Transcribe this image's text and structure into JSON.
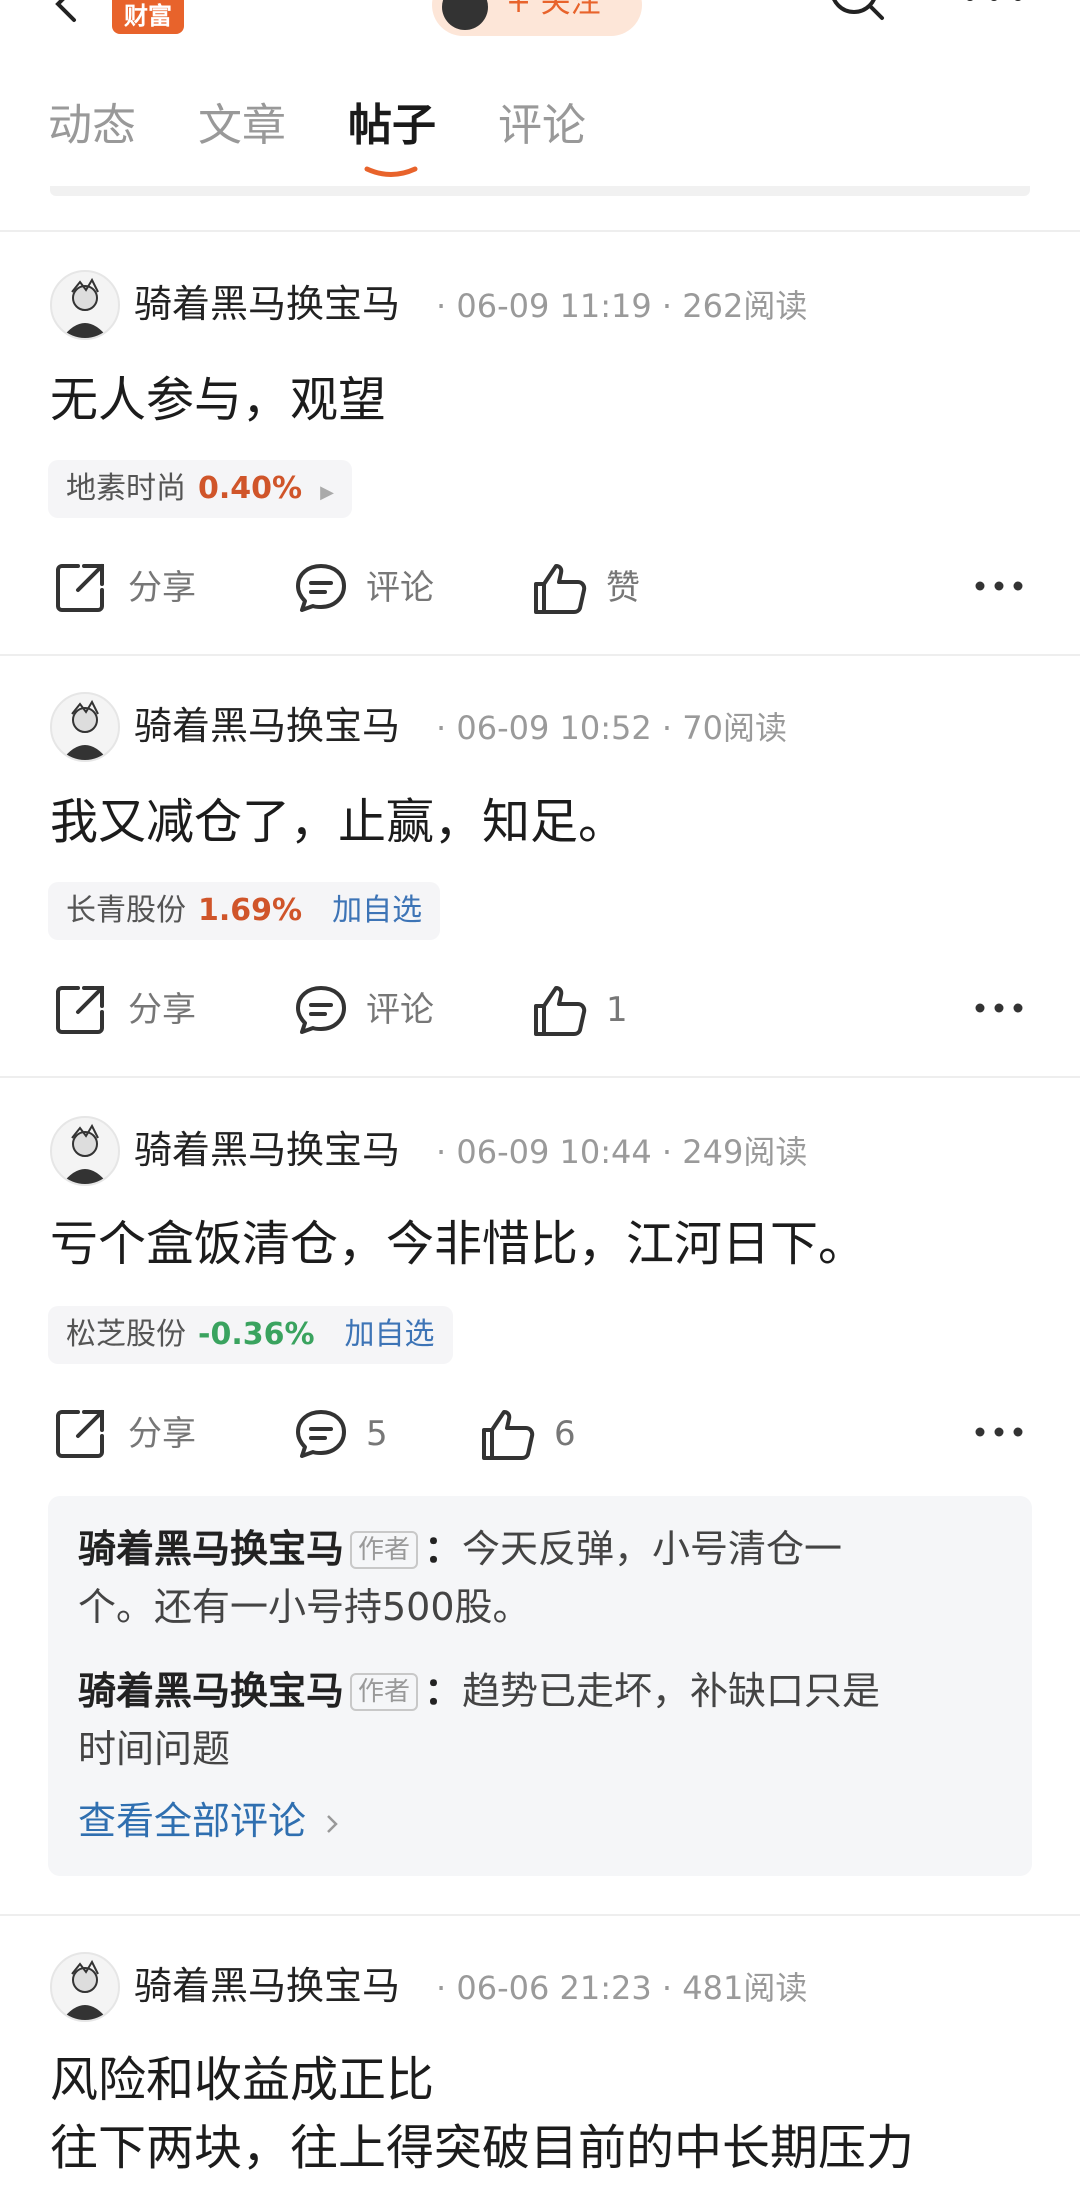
{
  "topbar": {
    "brand_badge": "财富",
    "follow_label": "+ 关注"
  },
  "tabs": [
    {
      "label": "动态"
    },
    {
      "label": "文章"
    },
    {
      "label": "帖子"
    },
    {
      "label": "评论"
    }
  ],
  "posts": [
    {
      "author": "骑着黑马换宝马",
      "time": "06-09 11:19",
      "reads": "262阅读",
      "text": [
        "无人参与，观望"
      ],
      "stock": {
        "name": "地素时尚",
        "change": "0.40%"
      },
      "share_label": "分享",
      "comment_label": "评论",
      "like_label": "赞"
    },
    {
      "author": "骑着黑马换宝马",
      "time": "06-09 10:52",
      "reads": "70阅读",
      "text": [
        "我又减仓了，止赢，知足。"
      ],
      "stock": {
        "name": "长青股份",
        "change": "1.69%",
        "add": "加自选"
      },
      "share_label": "分享",
      "comment_label": "评论",
      "like_label": "1"
    },
    {
      "author": "骑着黑马换宝马",
      "time": "06-09 10:44",
      "reads": "249阅读",
      "text": [
        "亏个盒饭清仓，今非惜比，江河日下。"
      ],
      "stock": {
        "name": "松芝股份",
        "change": "-0.36%",
        "add": "加自选"
      },
      "share_label": "分享",
      "comment_label": "5",
      "like_label": "6",
      "comments": [
        {
          "name": "骑着黑马换宝马",
          "tag": "作者",
          "text": "今天反弹，小号清仓一",
          "text2": "个。还有一小号持500股。"
        },
        {
          "name": "骑着黑马换宝马",
          "tag": "作者",
          "text": "趋势已走坏，补缺口只是",
          "text2": "时间问题"
        }
      ],
      "view_all": "查看全部评论"
    },
    {
      "author": "骑着黑马换宝马",
      "time": "06-06 21:23",
      "reads": "481阅读",
      "text": [
        "风险和收益成正比",
        "往下两块，往上得突破目前的中长期压力"
      ]
    }
  ],
  "colors": {
    "accent": "#e8632b",
    "up": "#d0552a",
    "down": "#3aa35f",
    "link": "#3d74b6"
  }
}
